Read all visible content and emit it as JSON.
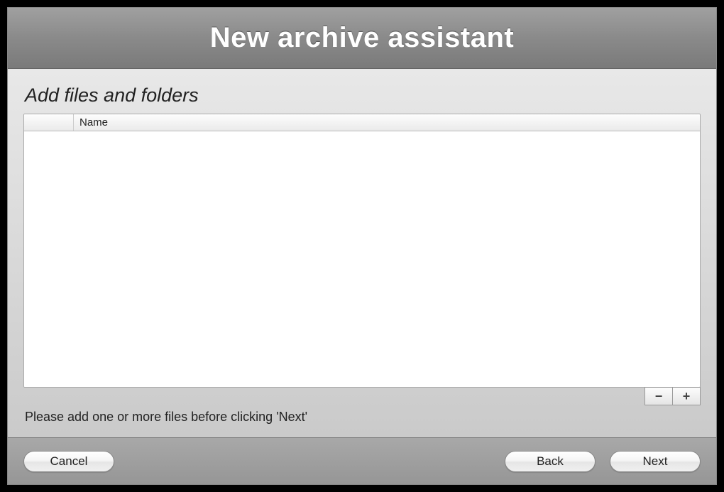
{
  "window": {
    "title": "New archive assistant"
  },
  "content": {
    "subtitle": "Add files and folders",
    "table": {
      "columns": {
        "name": "Name"
      },
      "rows": []
    },
    "hint": "Please add one or more files before clicking 'Next'",
    "remove_symbol": "−",
    "add_symbol": "+"
  },
  "footer": {
    "cancel": "Cancel",
    "back": "Back",
    "next": "Next"
  }
}
